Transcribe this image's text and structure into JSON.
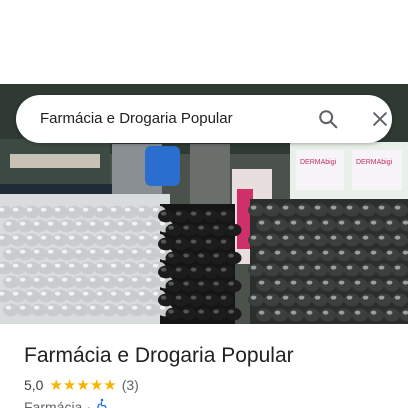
{
  "search": {
    "query": "Farmácia e Drogaria Popular",
    "search_icon": "search-icon",
    "close_icon": "close-icon"
  },
  "place": {
    "name": "Farmácia e Drogaria Popular",
    "rating": "5,0",
    "stars": 5,
    "review_count": "(3)",
    "category": "Farmácia",
    "separator": "·",
    "accessibility_icon": "wheelchair-icon"
  },
  "photo": {
    "shelf_label": "DERMAbigi"
  },
  "colors": {
    "star": "#f4b400",
    "accessibility": "#1a73e8",
    "text_primary": "#202124",
    "text_secondary": "#5f6368"
  }
}
